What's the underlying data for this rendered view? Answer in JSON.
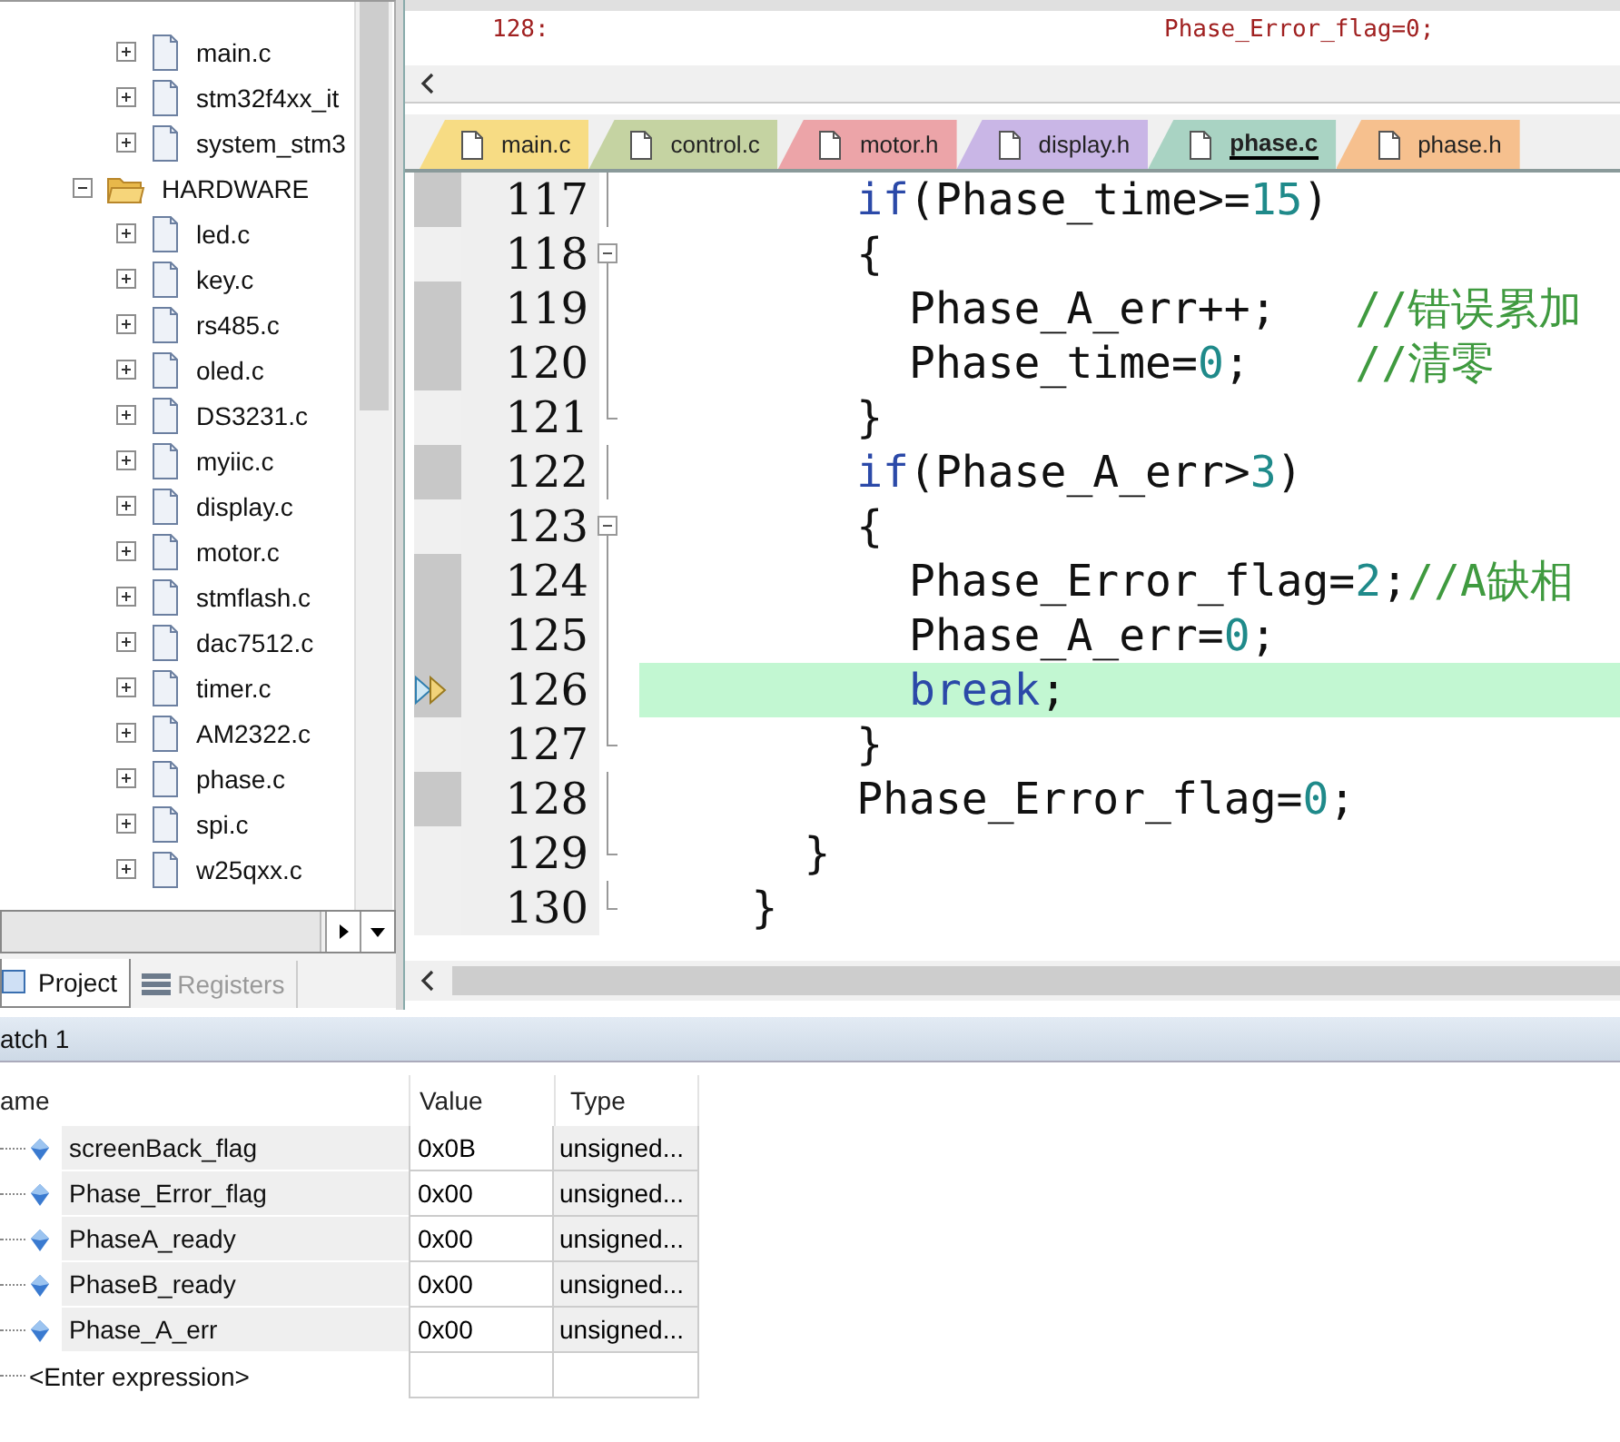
{
  "project_tree": [
    {
      "children": [
        {
          "label": "main.c",
          "kind": "file",
          "expanded": false
        },
        {
          "label": "stm32f4xx_it",
          "kind": "file",
          "expanded": false
        },
        {
          "label": "system_stm3",
          "kind": "file",
          "expanded": false
        }
      ]
    },
    {
      "label": "HARDWARE",
      "kind": "folder",
      "expanded": true,
      "children": [
        {
          "label": "led.c",
          "kind": "file",
          "expanded": false
        },
        {
          "label": "key.c",
          "kind": "file",
          "expanded": false
        },
        {
          "label": "rs485.c",
          "kind": "file",
          "expanded": false
        },
        {
          "label": "oled.c",
          "kind": "file",
          "expanded": false
        },
        {
          "label": "DS3231.c",
          "kind": "file",
          "expanded": false
        },
        {
          "label": "myiic.c",
          "kind": "file",
          "expanded": false
        },
        {
          "label": "display.c",
          "kind": "file",
          "expanded": false
        },
        {
          "label": "motor.c",
          "kind": "file",
          "expanded": false
        },
        {
          "label": "stmflash.c",
          "kind": "file",
          "expanded": false
        },
        {
          "label": "dac7512.c",
          "kind": "file",
          "expanded": false
        },
        {
          "label": "timer.c",
          "kind": "file",
          "expanded": false
        },
        {
          "label": "AM2322.c",
          "kind": "file",
          "expanded": false
        },
        {
          "label": "phase.c",
          "kind": "file",
          "expanded": false
        },
        {
          "label": "spi.c",
          "kind": "file",
          "expanded": false
        },
        {
          "label": "w25qxx.c",
          "kind": "file",
          "expanded": false
        }
      ]
    }
  ],
  "panel_tabs": [
    {
      "label": "Project",
      "kind": "project",
      "selected": true
    },
    {
      "label": "Registers",
      "kind": "registers",
      "selected": false
    }
  ],
  "disassembly": {
    "line_number": "128:",
    "code": "Phase_Error_flag=0;"
  },
  "editor_tabs": [
    {
      "label": "main.c",
      "color": "#f7dc84",
      "selected": false
    },
    {
      "label": "control.c",
      "color": "#c5d3a2",
      "selected": false
    },
    {
      "label": "motor.h",
      "color": "#eca4a8",
      "selected": false
    },
    {
      "label": "display.h",
      "color": "#c9b6e6",
      "selected": false
    },
    {
      "label": "phase.c",
      "color": "#a9d3c3",
      "selected": true
    },
    {
      "label": "phase.h",
      "color": "#f6c08e",
      "selected": false
    }
  ],
  "code_lines": [
    {
      "number": "117",
      "executable": true,
      "current": false,
      "fold_start": false,
      "fold_end": false,
      "tokens": [
        {
          "kind": "keyword",
          "text": "        if"
        },
        {
          "kind": "plain",
          "text": "(Phase_time>="
        },
        {
          "kind": "number",
          "text": "15"
        },
        {
          "kind": "plain",
          "text": ")"
        }
      ]
    },
    {
      "number": "118",
      "executable": false,
      "current": false,
      "fold_start": true,
      "fold_end": false,
      "tokens": [
        {
          "kind": "plain",
          "text": "        {"
        }
      ]
    },
    {
      "number": "119",
      "executable": true,
      "current": false,
      "fold_start": false,
      "fold_end": false,
      "tokens": [
        {
          "kind": "plain",
          "text": "          Phase_A_err++;   "
        },
        {
          "kind": "comment",
          "text": "//错误累加"
        }
      ]
    },
    {
      "number": "120",
      "executable": true,
      "current": false,
      "fold_start": false,
      "fold_end": false,
      "tokens": [
        {
          "kind": "plain",
          "text": "          Phase_time="
        },
        {
          "kind": "number",
          "text": "0"
        },
        {
          "kind": "plain",
          "text": ";    "
        },
        {
          "kind": "comment",
          "text": "//清零"
        }
      ]
    },
    {
      "number": "121",
      "executable": false,
      "current": false,
      "fold_start": false,
      "fold_end": true,
      "tokens": [
        {
          "kind": "plain",
          "text": "        }"
        }
      ]
    },
    {
      "number": "122",
      "executable": true,
      "current": false,
      "fold_start": false,
      "fold_end": false,
      "tokens": [
        {
          "kind": "keyword",
          "text": "        if"
        },
        {
          "kind": "plain",
          "text": "(Phase_A_err>"
        },
        {
          "kind": "number",
          "text": "3"
        },
        {
          "kind": "plain",
          "text": ")"
        }
      ]
    },
    {
      "number": "123",
      "executable": false,
      "current": false,
      "fold_start": true,
      "fold_end": false,
      "tokens": [
        {
          "kind": "plain",
          "text": "        {"
        }
      ]
    },
    {
      "number": "124",
      "executable": true,
      "current": false,
      "fold_start": false,
      "fold_end": false,
      "tokens": [
        {
          "kind": "plain",
          "text": "          Phase_Error_flag="
        },
        {
          "kind": "number",
          "text": "2"
        },
        {
          "kind": "plain",
          "text": ";"
        },
        {
          "kind": "comment",
          "text": "//A缺相"
        }
      ]
    },
    {
      "number": "125",
      "executable": true,
      "current": false,
      "fold_start": false,
      "fold_end": false,
      "tokens": [
        {
          "kind": "plain",
          "text": "          Phase_A_err="
        },
        {
          "kind": "number",
          "text": "0"
        },
        {
          "kind": "plain",
          "text": ";"
        }
      ]
    },
    {
      "number": "126",
      "executable": true,
      "current": true,
      "fold_start": false,
      "fold_end": false,
      "tokens": [
        {
          "kind": "keyword",
          "text": "          break"
        },
        {
          "kind": "plain",
          "text": ";"
        }
      ]
    },
    {
      "number": "127",
      "executable": false,
      "current": false,
      "fold_start": false,
      "fold_end": true,
      "tokens": [
        {
          "kind": "plain",
          "text": "        }"
        }
      ]
    },
    {
      "number": "128",
      "executable": true,
      "current": false,
      "fold_start": false,
      "fold_end": false,
      "tokens": [
        {
          "kind": "plain",
          "text": "        Phase_Error_flag="
        },
        {
          "kind": "number",
          "text": "0"
        },
        {
          "kind": "plain",
          "text": ";"
        }
      ]
    },
    {
      "number": "129",
      "executable": false,
      "current": false,
      "fold_start": false,
      "fold_end": true,
      "tokens": [
        {
          "kind": "plain",
          "text": "      }"
        }
      ]
    },
    {
      "number": "130",
      "executable": false,
      "current": false,
      "fold_start": false,
      "fold_end": true,
      "tokens": [
        {
          "kind": "plain",
          "text": "    }"
        }
      ]
    }
  ],
  "watch": {
    "title": "atch 1",
    "columns": [
      "ame",
      "Value",
      "Type"
    ],
    "rows": [
      {
        "name": "screenBack_flag",
        "value": "0x0B",
        "type": "unsigned..."
      },
      {
        "name": "Phase_Error_flag",
        "value": "0x00",
        "type": "unsigned..."
      },
      {
        "name": "PhaseA_ready",
        "value": "0x00",
        "type": "unsigned..."
      },
      {
        "name": "PhaseB_ready",
        "value": "0x00",
        "type": "unsigned..."
      },
      {
        "name": "Phase_A_err",
        "value": "0x00",
        "type": "unsigned..."
      }
    ],
    "placeholder": "<Enter expression>"
  }
}
